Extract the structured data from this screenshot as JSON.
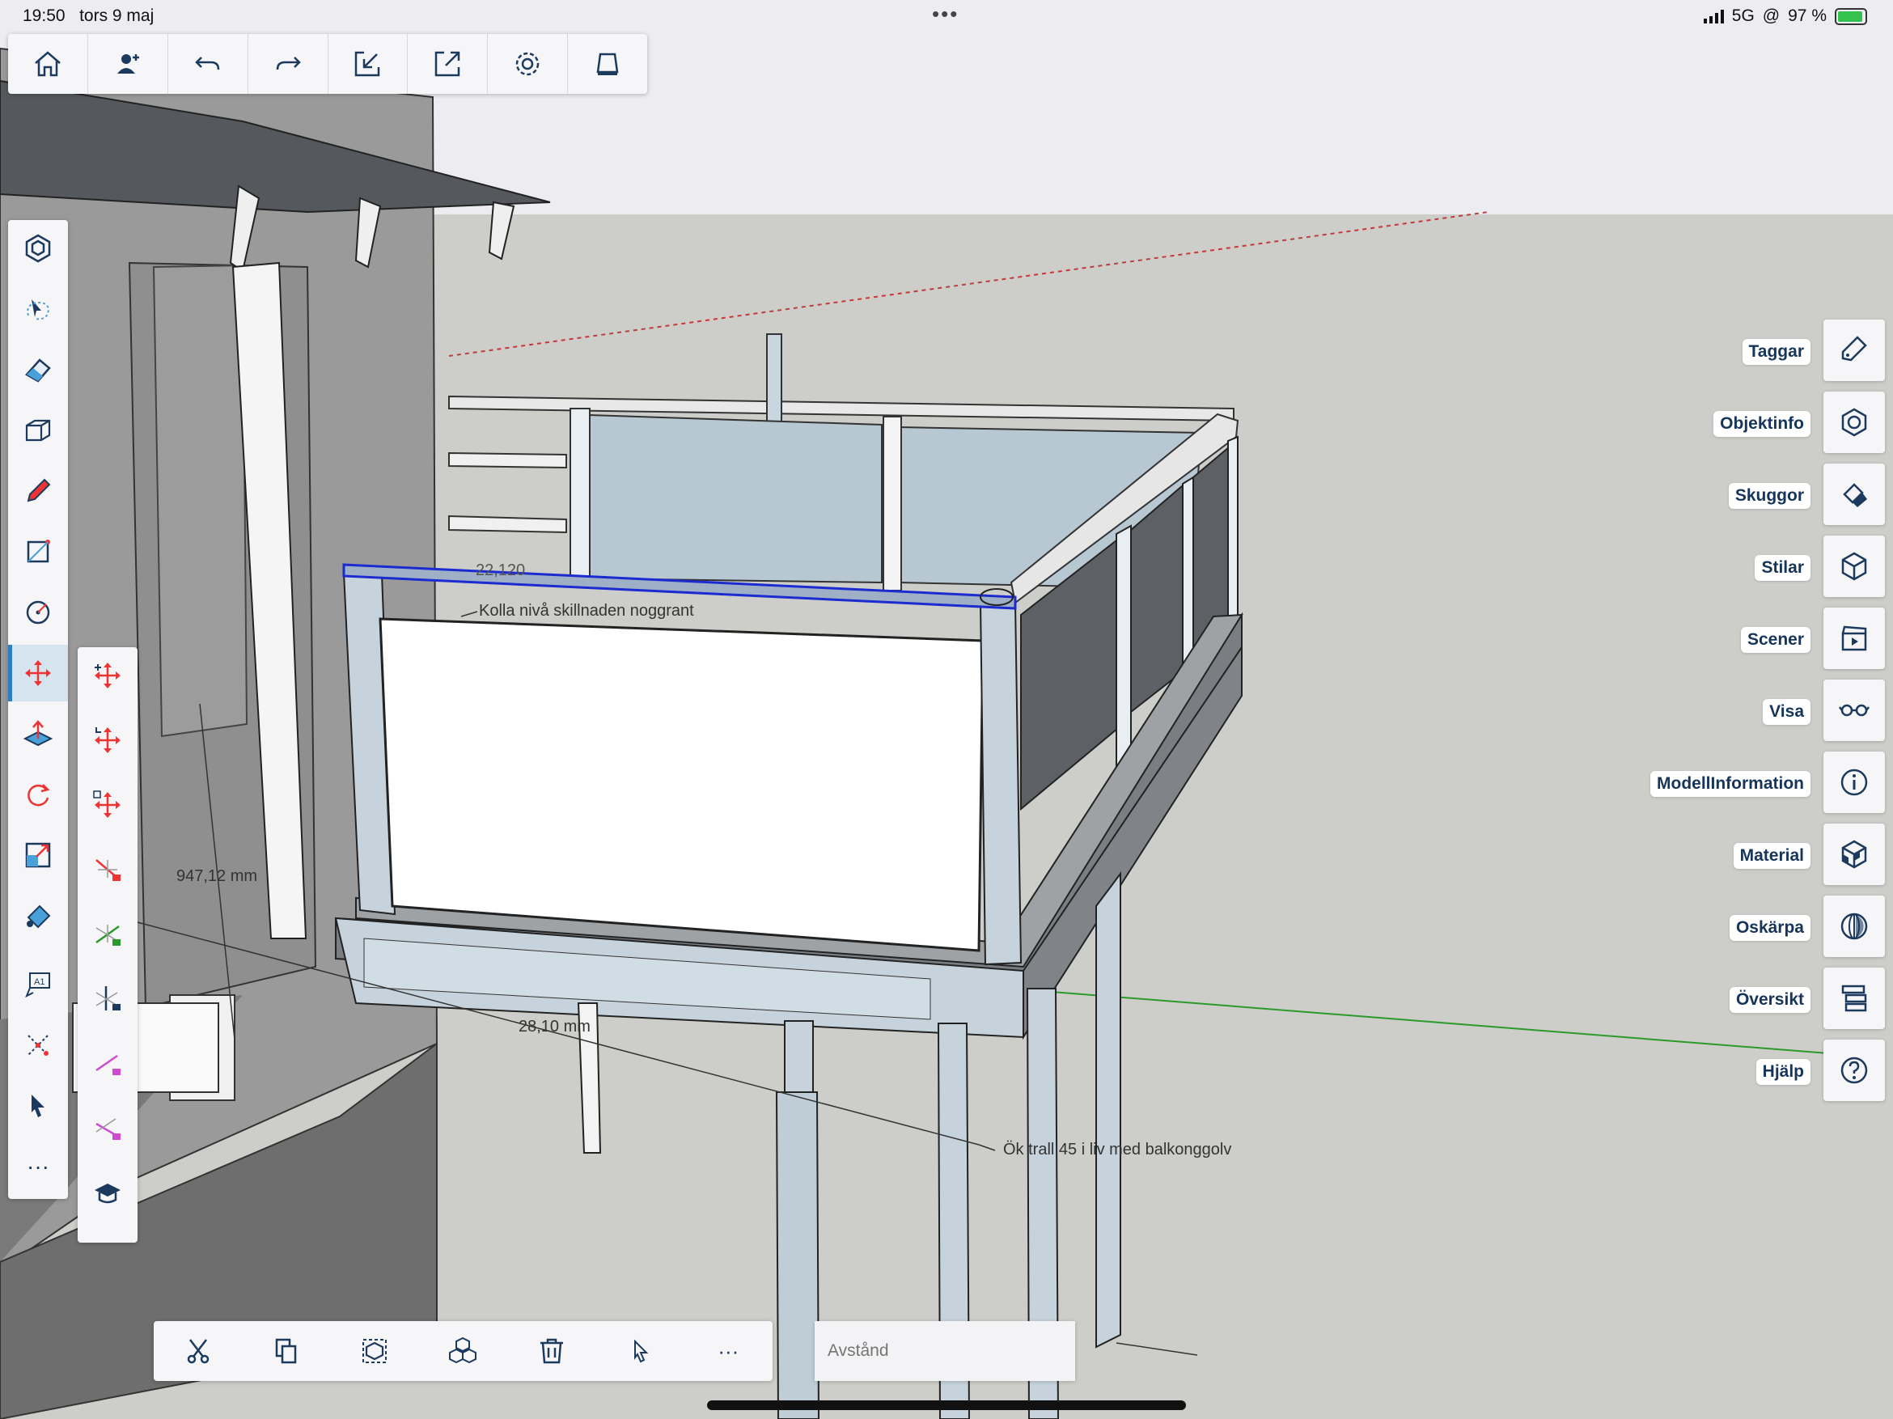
{
  "status_bar": {
    "time": "19:50",
    "date": "tors 9 maj",
    "network": "5G",
    "battery": "97 %",
    "more": "•••"
  },
  "top_toolbar": {
    "buttons": [
      "home-icon",
      "add-user-icon",
      "undo-icon",
      "redo-icon",
      "import-icon",
      "export-icon",
      "settings-icon",
      "viewer-icon"
    ]
  },
  "left_toolbar": {
    "tools": [
      "component-icon",
      "lasso-select-icon",
      "eraser-icon",
      "push-pull-box-icon",
      "pencil-icon",
      "rectangle-icon",
      "circle-icon",
      "move-icon",
      "push-pull-icon",
      "rotate-icon",
      "scale-icon",
      "paint-bucket-icon",
      "text-label-icon",
      "axes-icon",
      "cursor-icon"
    ],
    "more_label": "···",
    "active": "move-icon"
  },
  "move_submenu": {
    "tools": [
      "move-free-icon",
      "move-vertical-icon",
      "move-copy-icon",
      "lock-red-axis-icon",
      "lock-green-axis-icon",
      "lock-blue-axis-icon",
      "lock-magenta-icon",
      "lock-magenta-parallel-icon",
      "tutorial-icon"
    ]
  },
  "bottom_toolbar": {
    "buttons": [
      "cut-icon",
      "copy-icon",
      "select-group-icon",
      "component-icon",
      "delete-icon",
      "cursor-icon"
    ],
    "more_label": "···"
  },
  "measurement_box": {
    "placeholder": "Avstånd"
  },
  "right_panel": [
    {
      "label": "Taggar",
      "icon": "tag-icon"
    },
    {
      "label": "Objektinfo",
      "icon": "entity-info-icon"
    },
    {
      "label": "Skuggor",
      "icon": "shadow-icon"
    },
    {
      "label": "Stilar",
      "icon": "styles-icon"
    },
    {
      "label": "Scener",
      "icon": "scenes-icon"
    },
    {
      "label": "Visa",
      "icon": "glasses-icon"
    },
    {
      "label": "ModellInformation",
      "icon": "info-icon"
    },
    {
      "label": "Material",
      "icon": "material-icon"
    },
    {
      "label": "Oskärpa",
      "icon": "globe-icon"
    },
    {
      "label": "Översikt",
      "icon": "outliner-icon"
    },
    {
      "label": "Hjälp",
      "icon": "help-icon"
    }
  ],
  "model_annotations": {
    "note1": "Kolla nivå skillnaden noggrant",
    "note2": "Ök trall 45 i liv med balkonggolv",
    "dim1": "947,12 mm",
    "dim2": "28,10 mm",
    "dim3": "22,120"
  }
}
